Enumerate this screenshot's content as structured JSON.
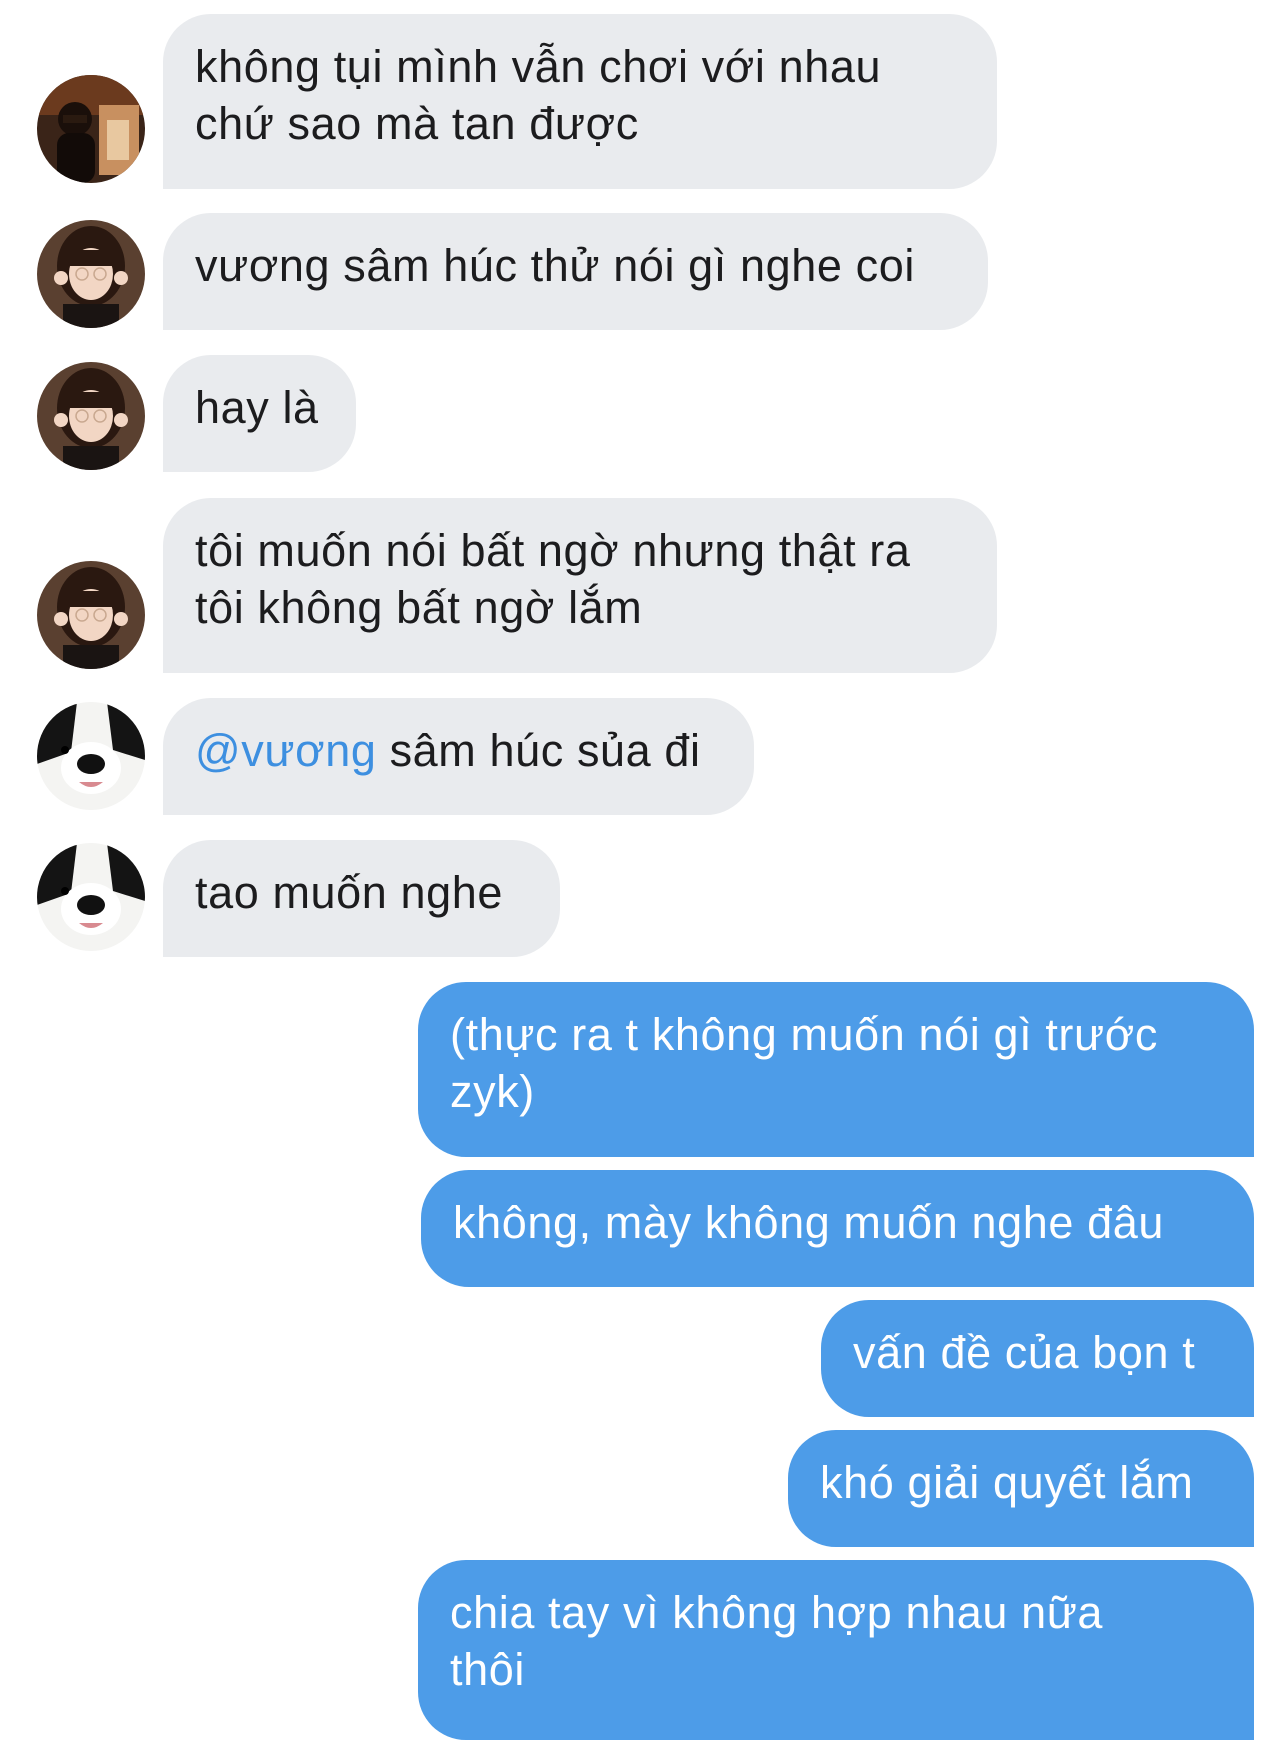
{
  "messages": [
    {
      "from": "them",
      "sender_avatar": "avatar-boy-photo",
      "lines": [
        "không tụi mình vẫn chơi với nhau",
        "chứ sao mà tan được"
      ]
    },
    {
      "from": "them",
      "sender_avatar": "avatar-girl-photo",
      "lines": [
        "vương sâm húc thử nói gì nghe coi"
      ]
    },
    {
      "from": "them",
      "sender_avatar": "avatar-girl-photo",
      "lines": [
        "hay là"
      ]
    },
    {
      "from": "them",
      "sender_avatar": "avatar-girl-photo",
      "lines": [
        "tôi muốn nói bất ngờ nhưng thật ra",
        "tôi không bất ngờ lắm"
      ]
    },
    {
      "from": "them",
      "sender_avatar": "avatar-dog-photo",
      "mention": "@vương",
      "text": " sâm húc sủa đi"
    },
    {
      "from": "them",
      "sender_avatar": "avatar-dog-photo",
      "lines": [
        "tao muốn nghe"
      ]
    },
    {
      "from": "me",
      "lines": [
        "(thực ra t không muốn nói gì trước",
        "zyk)"
      ]
    },
    {
      "from": "me",
      "lines": [
        "không, mày không muốn nghe đâu"
      ]
    },
    {
      "from": "me",
      "lines": [
        "vấn đề của bọn t"
      ]
    },
    {
      "from": "me",
      "lines": [
        "khó giải quyết lắm"
      ]
    },
    {
      "from": "me",
      "lines": [
        "chia tay vì không hợp nhau nữa",
        "thôi"
      ]
    }
  ],
  "colors": {
    "incoming_bubble": "#e9ebee",
    "outgoing_bubble": "#4d9ce8",
    "mention": "#3d8fe0",
    "incoming_text": "#1c1c1e",
    "outgoing_text": "#ffffff"
  }
}
